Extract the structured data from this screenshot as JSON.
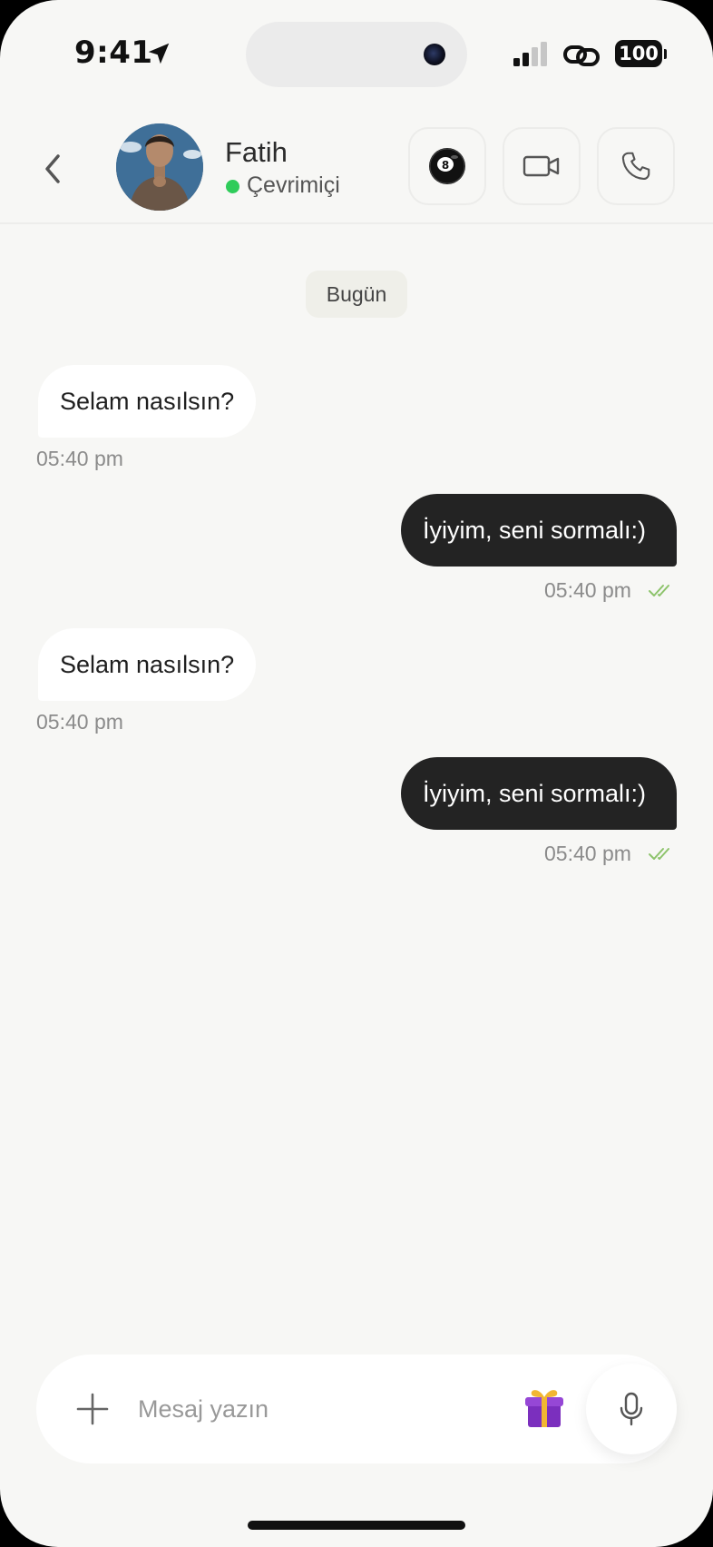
{
  "status_bar": {
    "time": "9:41",
    "battery": "100",
    "icons": [
      "location-arrow-icon",
      "signal-icon",
      "link-icon",
      "battery-icon"
    ]
  },
  "header": {
    "contact_name": "Fatih",
    "status_text": "Çevrimiçi",
    "status_color": "#2fcc5a",
    "actions": [
      "8-ball-icon",
      "video-camera-icon",
      "phone-icon"
    ]
  },
  "chat": {
    "date_label": "Bugün",
    "messages": [
      {
        "direction": "incoming",
        "text": "Selam nasılsın?",
        "time": "05:40 pm"
      },
      {
        "direction": "outgoing",
        "text": "İyiyim, seni sormalı:)",
        "time": "05:40 pm",
        "read": true
      },
      {
        "direction": "incoming",
        "text": "Selam nasılsın?",
        "time": "05:40 pm"
      },
      {
        "direction": "outgoing",
        "text": "İyiyim, seni sormalı:)",
        "time": "05:40 pm",
        "read": true
      }
    ]
  },
  "composer": {
    "placeholder": "Mesaj yazın",
    "value": ""
  },
  "colors": {
    "background": "#f7f7f5",
    "outgoing_bubble": "#232323",
    "incoming_bubble": "#ffffff",
    "read_check": "#8dc36b"
  }
}
